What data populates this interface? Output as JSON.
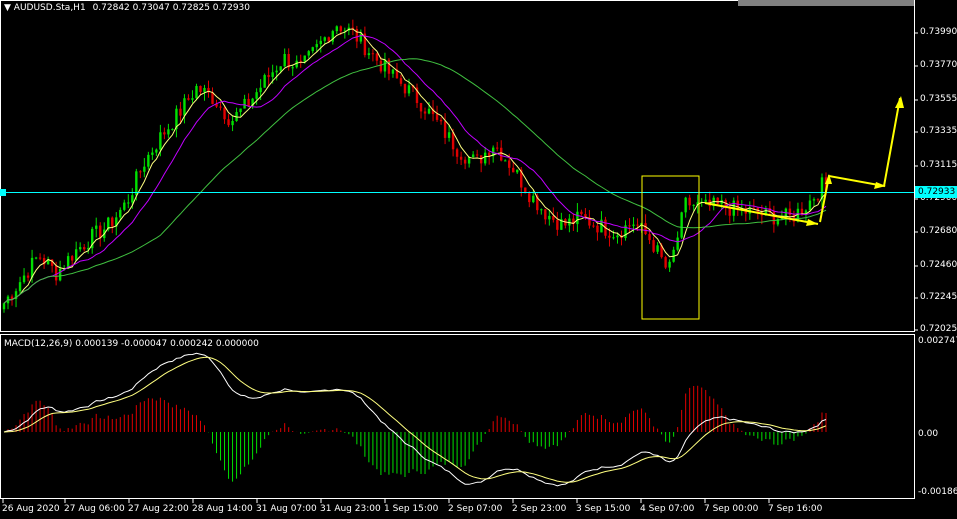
{
  "header": {
    "arrow": "▼",
    "symbol": "AUDUSD.Sta,H1",
    "ohlc": "0.72842 0.73047 0.72825 0.72930"
  },
  "macd_header": {
    "label": "MACD(12,26,9)",
    "values": "0.000139 -0.000047 0.000242 0.000000"
  },
  "price_axis": {
    "labels": [
      "0.73990",
      "0.73770",
      "0.73555",
      "0.73335",
      "0.73115",
      "0.72900",
      "0.72680",
      "0.72460",
      "0.72245",
      "0.72025"
    ],
    "current_price": "0.72933"
  },
  "macd_axis": {
    "labels": [
      "0.002747",
      "0.00",
      "-0.001862"
    ]
  },
  "time_axis": {
    "labels": [
      "26 Aug 2020",
      "27 Aug 06:00",
      "27 Aug 22:00",
      "28 Aug 14:00",
      "31 Aug 07:00",
      "31 Aug 23:00",
      "1 Sep 15:00",
      "2 Sep 07:00",
      "2 Sep 23:00",
      "3 Sep 15:00",
      "4 Sep 07:00",
      "7 Sep 00:00",
      "7 Sep 16:00"
    ]
  },
  "colors": {
    "background": "#000000",
    "bull_candle": "#00e000",
    "bear_candle": "#e00000",
    "ma_fast": "#ffff80",
    "ma_mid": "#c000ff",
    "ma_slow": "#40c040",
    "hline": "#00ffff",
    "annotation": "#ffff00",
    "grid_border": "#ffffff"
  },
  "chart_data": {
    "type": "candlestick",
    "price_range": [
      0.72,
      0.7414
    ],
    "anchor_closes": [
      0.7218,
      0.7234,
      0.725,
      0.7238,
      0.7252,
      0.7262,
      0.727,
      0.7285,
      0.7312,
      0.733,
      0.7345,
      0.7362,
      0.7355,
      0.734,
      0.7352,
      0.7368,
      0.7382,
      0.7375,
      0.739,
      0.7405,
      0.7398,
      0.7385,
      0.7372,
      0.7362,
      0.735,
      0.7335,
      0.732,
      0.7312,
      0.7325,
      0.731,
      0.7292,
      0.7278,
      0.727,
      0.7275,
      0.727,
      0.7265,
      0.7272,
      0.726,
      0.7238,
      0.7285,
      0.7282,
      0.7283,
      0.728,
      0.7278,
      0.7276,
      0.7275,
      0.7285,
      0.73
    ],
    "macd_range": [
      -0.001862,
      0.002747
    ],
    "current_price": 0.72933
  }
}
